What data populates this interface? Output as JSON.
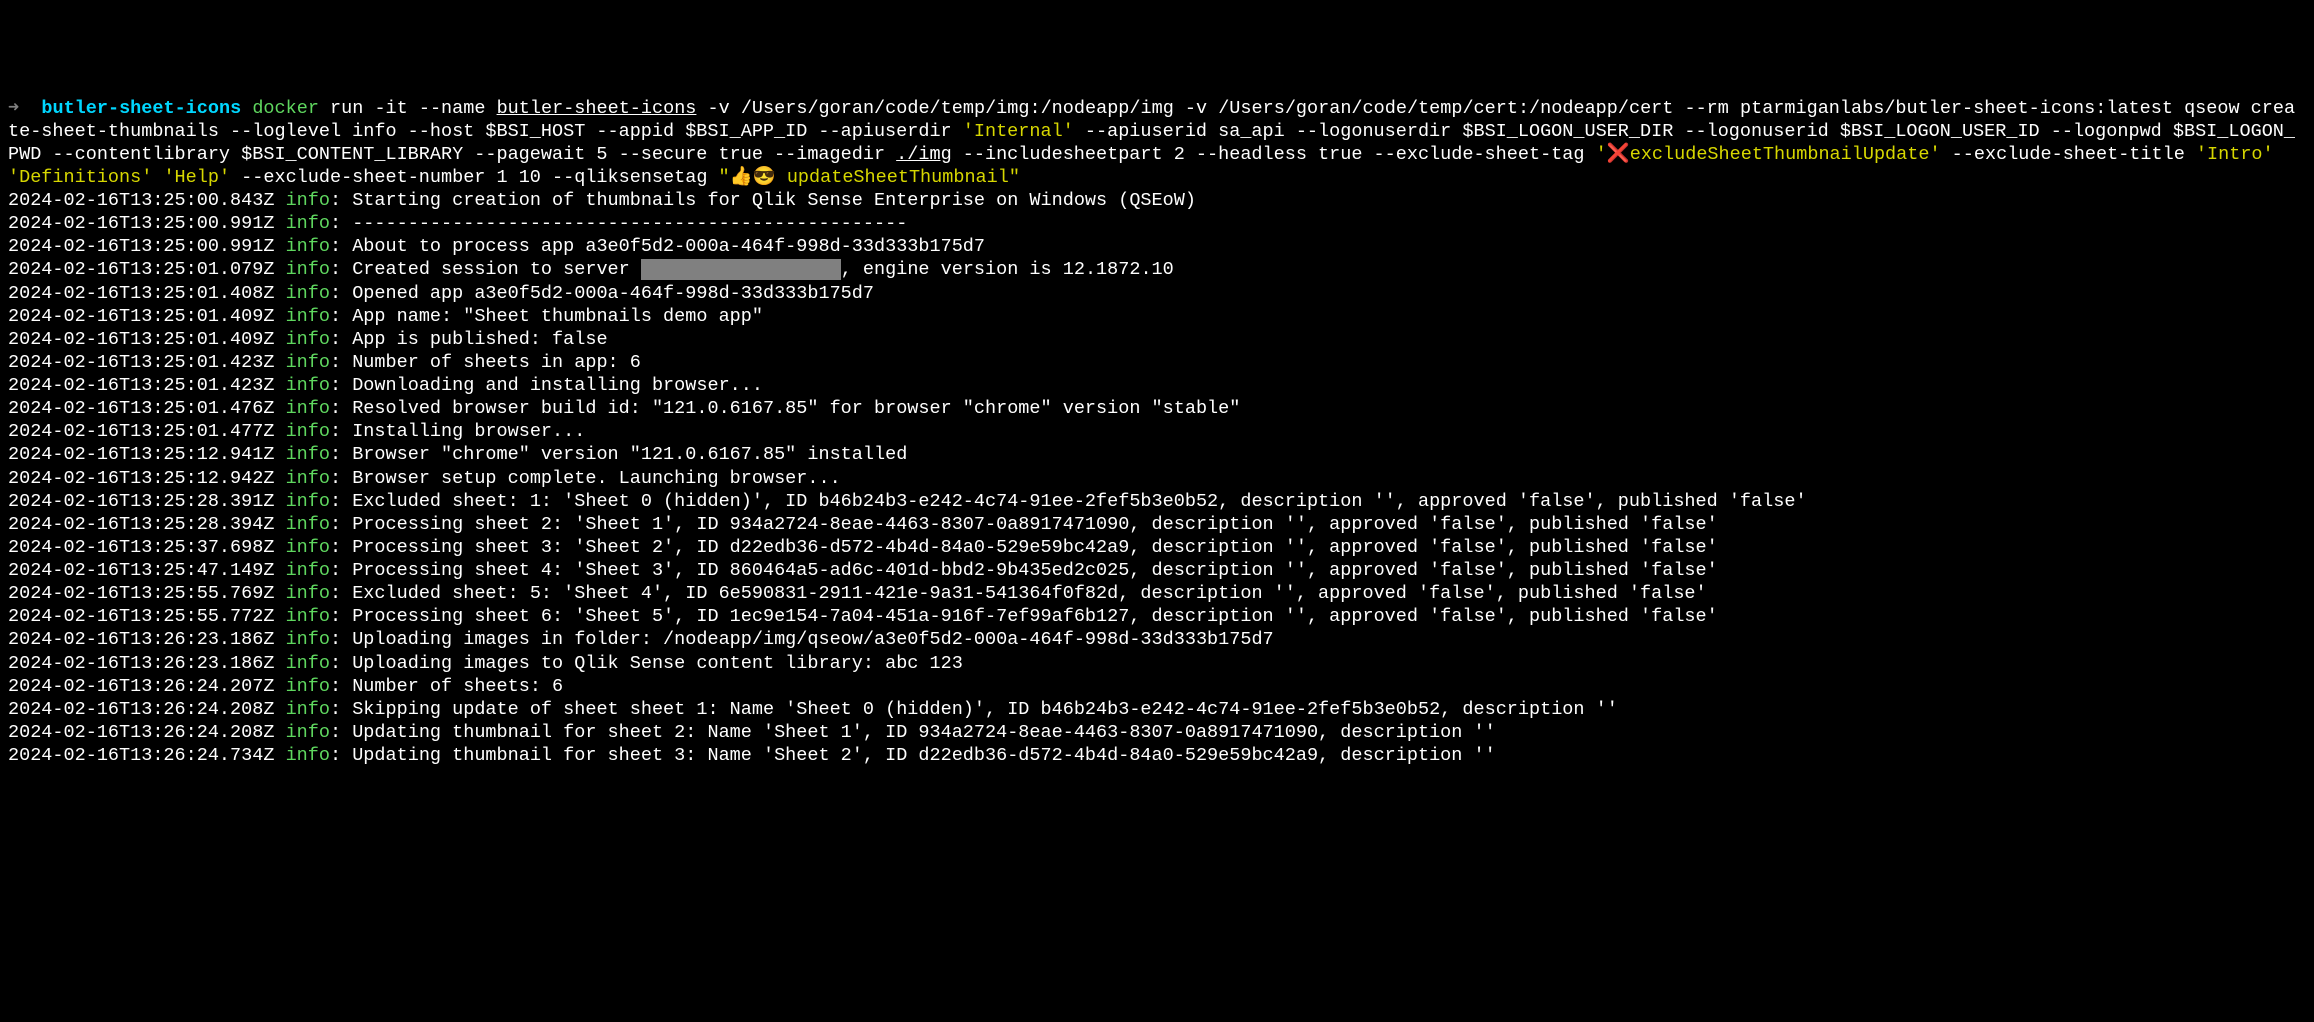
{
  "prompt": {
    "arrow": "➜",
    "dir": "butler-sheet-icons",
    "docker": "docker",
    "args_plain_1": " run -it --name ",
    "args_underline_1": "butler-sheet-icons",
    "args_plain_2": " -v /Users/goran/code/temp/img:/nodeapp/img -v /Users/goran/code/temp/cert:/nodeapp/cert --rm ptarmiganlabs/butler-sheet-icons:latest qseow create-sheet-thumbnails --loglevel info --host $BSI_HOST --appid $BSI_APP_ID --apiuserdir ",
    "args_yellow_1": "'Internal'",
    "args_plain_3": " --apiuserid sa_api --logonuserdir $BSI_LOGON_USER_DIR --logonuserid $BSI_LOGON_USER_ID --logonpwd $BSI_LOGON_PWD --contentlibrary $BSI_CONTENT_LIBRARY --pagewait 5 --secure true --imagedir ",
    "args_underline_2": "./img",
    "args_plain_4": " --includesheetpart 2 --headless true --exclude-sheet-tag ",
    "args_yellow_2": "'❌excludeSheetThumbnailUpdate'",
    "args_plain_5": " --exclude-sheet-title ",
    "args_yellow_3": "'Intro'",
    "args_plain_5a": " ",
    "args_yellow_4": "'Definitions'",
    "args_plain_5b": " ",
    "args_yellow_5": "'Help'",
    "args_plain_6": " --exclude-sheet-number 1 10 --qliksensetag ",
    "args_yellow_6": "\"👍😎 updateSheetThumbnail\""
  },
  "log": [
    {
      "ts": "2024-02-16T13:25:00.843Z",
      "level": "info",
      "msg": "Starting creation of thumbnails for Qlik Sense Enterprise on Windows (QSEoW)"
    },
    {
      "ts": "2024-02-16T13:25:00.991Z",
      "level": "info",
      "msg": "--------------------------------------------------"
    },
    {
      "ts": "2024-02-16T13:25:00.991Z",
      "level": "info",
      "msg": "About to process app a3e0f5d2-000a-464f-998d-33d333b175d7"
    },
    {
      "ts": "2024-02-16T13:25:01.079Z",
      "level": "info",
      "msg_pre": "Created session to server ",
      "redacted": "xxxxxxxxxxxxxxxxxx",
      "msg_post": ", engine version is 12.1872.10"
    },
    {
      "ts": "2024-02-16T13:25:01.408Z",
      "level": "info",
      "msg": "Opened app a3e0f5d2-000a-464f-998d-33d333b175d7"
    },
    {
      "ts": "2024-02-16T13:25:01.409Z",
      "level": "info",
      "msg": "App name: \"Sheet thumbnails demo app\""
    },
    {
      "ts": "2024-02-16T13:25:01.409Z",
      "level": "info",
      "msg": "App is published: false"
    },
    {
      "ts": "2024-02-16T13:25:01.423Z",
      "level": "info",
      "msg": "Number of sheets in app: 6"
    },
    {
      "ts": "2024-02-16T13:25:01.423Z",
      "level": "info",
      "msg": "Downloading and installing browser..."
    },
    {
      "ts": "2024-02-16T13:25:01.476Z",
      "level": "info",
      "msg": "Resolved browser build id: \"121.0.6167.85\" for browser \"chrome\" version \"stable\""
    },
    {
      "ts": "2024-02-16T13:25:01.477Z",
      "level": "info",
      "msg": "Installing browser..."
    },
    {
      "ts": "2024-02-16T13:25:12.941Z",
      "level": "info",
      "msg": "Browser \"chrome\" version \"121.0.6167.85\" installed"
    },
    {
      "ts": "2024-02-16T13:25:12.942Z",
      "level": "info",
      "msg": "Browser setup complete. Launching browser..."
    },
    {
      "ts": "2024-02-16T13:25:28.391Z",
      "level": "info",
      "msg": "Excluded sheet: 1: 'Sheet 0 (hidden)', ID b46b24b3-e242-4c74-91ee-2fef5b3e0b52, description '', approved 'false', published 'false'"
    },
    {
      "ts": "2024-02-16T13:25:28.394Z",
      "level": "info",
      "msg": "Processing sheet 2: 'Sheet 1', ID 934a2724-8eae-4463-8307-0a8917471090, description '', approved 'false', published 'false'"
    },
    {
      "ts": "2024-02-16T13:25:37.698Z",
      "level": "info",
      "msg": "Processing sheet 3: 'Sheet 2', ID d22edb36-d572-4b4d-84a0-529e59bc42a9, description '', approved 'false', published 'false'"
    },
    {
      "ts": "2024-02-16T13:25:47.149Z",
      "level": "info",
      "msg": "Processing sheet 4: 'Sheet 3', ID 860464a5-ad6c-401d-bbd2-9b435ed2c025, description '', approved 'false', published 'false'"
    },
    {
      "ts": "2024-02-16T13:25:55.769Z",
      "level": "info",
      "msg": "Excluded sheet: 5: 'Sheet 4', ID 6e590831-2911-421e-9a31-541364f0f82d, description '', approved 'false', published 'false'"
    },
    {
      "ts": "2024-02-16T13:25:55.772Z",
      "level": "info",
      "msg": "Processing sheet 6: 'Sheet 5', ID 1ec9e154-7a04-451a-916f-7ef99af6b127, description '', approved 'false', published 'false'"
    },
    {
      "ts": "2024-02-16T13:26:23.186Z",
      "level": "info",
      "msg": "Uploading images in folder: /nodeapp/img/qseow/a3e0f5d2-000a-464f-998d-33d333b175d7"
    },
    {
      "ts": "2024-02-16T13:26:23.186Z",
      "level": "info",
      "msg": "Uploading images to Qlik Sense content library: abc 123"
    },
    {
      "ts": "2024-02-16T13:26:24.207Z",
      "level": "info",
      "msg": "Number of sheets: 6"
    },
    {
      "ts": "2024-02-16T13:26:24.208Z",
      "level": "info",
      "msg": "Skipping update of sheet sheet 1: Name 'Sheet 0 (hidden)', ID b46b24b3-e242-4c74-91ee-2fef5b3e0b52, description ''"
    },
    {
      "ts": "2024-02-16T13:26:24.208Z",
      "level": "info",
      "msg": "Updating thumbnail for sheet 2: Name 'Sheet 1', ID 934a2724-8eae-4463-8307-0a8917471090, description ''"
    },
    {
      "ts": "2024-02-16T13:26:24.734Z",
      "level": "info",
      "msg": "Updating thumbnail for sheet 3: Name 'Sheet 2', ID d22edb36-d572-4b4d-84a0-529e59bc42a9, description ''"
    }
  ]
}
